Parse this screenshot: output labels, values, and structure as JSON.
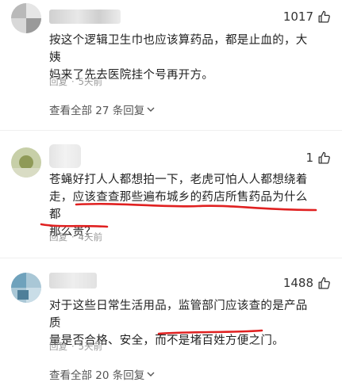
{
  "comments": [
    {
      "likes": "1017",
      "text_lines": [
        "按这个逻辑卫生巾也应该算药品，都是止血的，大姨",
        "妈来了先去医院挂个号再开方。"
      ],
      "reply_label": "回复",
      "time": "5天前",
      "view_all": "查看全部 27 条回复"
    },
    {
      "likes": "1",
      "text_lines": [
        "苍蝇好打人人都想拍一下，老虎可怕人人都想绕着",
        "走，应该查查那些遍布城乡的药店所售药品为什么都",
        "那么贵？"
      ],
      "reply_label": "回复",
      "time": "4天前"
    },
    {
      "likes": "1488",
      "text_lines": [
        "对于这些日常生活用品，监管部门应该查的是产品质",
        "量是否合格、安全，而不是堵百姓方便之门。"
      ],
      "reply_label": "回复",
      "time": "5天前",
      "view_all": "查看全部 20 条回复"
    }
  ],
  "colors": {
    "annotation": "#e02020",
    "meta": "#999999"
  },
  "icons": {
    "like": "thumbs-up-icon",
    "expand": "chevron-down-icon"
  }
}
